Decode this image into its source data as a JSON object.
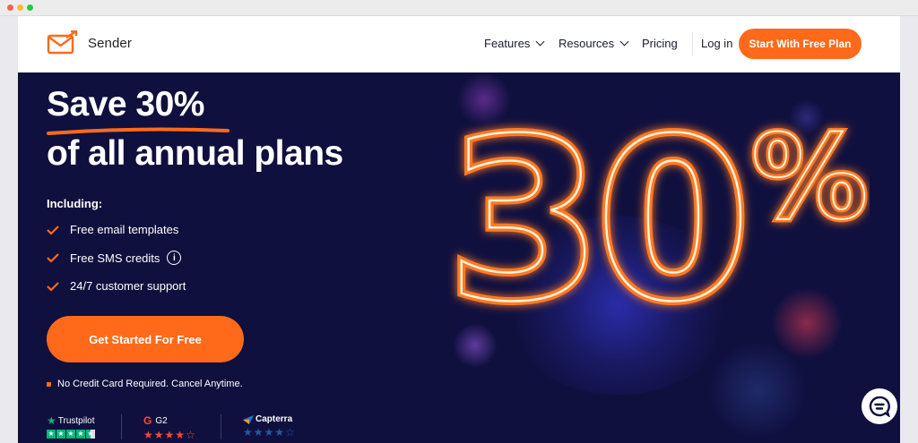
{
  "nav": {
    "brand": "Sender",
    "items": [
      {
        "label": "Features",
        "has_dropdown": true
      },
      {
        "label": "Resources",
        "has_dropdown": true
      },
      {
        "label": "Pricing",
        "has_dropdown": false
      }
    ],
    "login": "Log in",
    "cta": "Start With Free Plan"
  },
  "hero": {
    "headline_highlight": "Save 30%",
    "headline_rest": "of all annual plans",
    "including_label": "Including:",
    "features": [
      {
        "label": "Free email templates",
        "info": false
      },
      {
        "label": "Free SMS credits",
        "info": true
      },
      {
        "label": "24/7 customer support",
        "info": false
      }
    ],
    "cta": "Get Started For Free",
    "disclaimer": "No Credit Card Required. Cancel Anytime.",
    "big_number": "30",
    "big_symbol": "%"
  },
  "ratings": [
    {
      "name": "Trustpilot",
      "icon": "trustpilot-star-icon",
      "stars": 4.5
    },
    {
      "name": "G2",
      "icon": "g2-logo-icon",
      "stars": 4.5
    },
    {
      "name": "Capterra",
      "icon": "capterra-logo-icon",
      "stars": 4.5
    }
  ],
  "colors": {
    "accent": "#ff6a1a",
    "hero_bg": "#10103f",
    "trustpilot": "#00b67a",
    "g2": "#ff492c",
    "capterra": "#1f5aa6"
  }
}
